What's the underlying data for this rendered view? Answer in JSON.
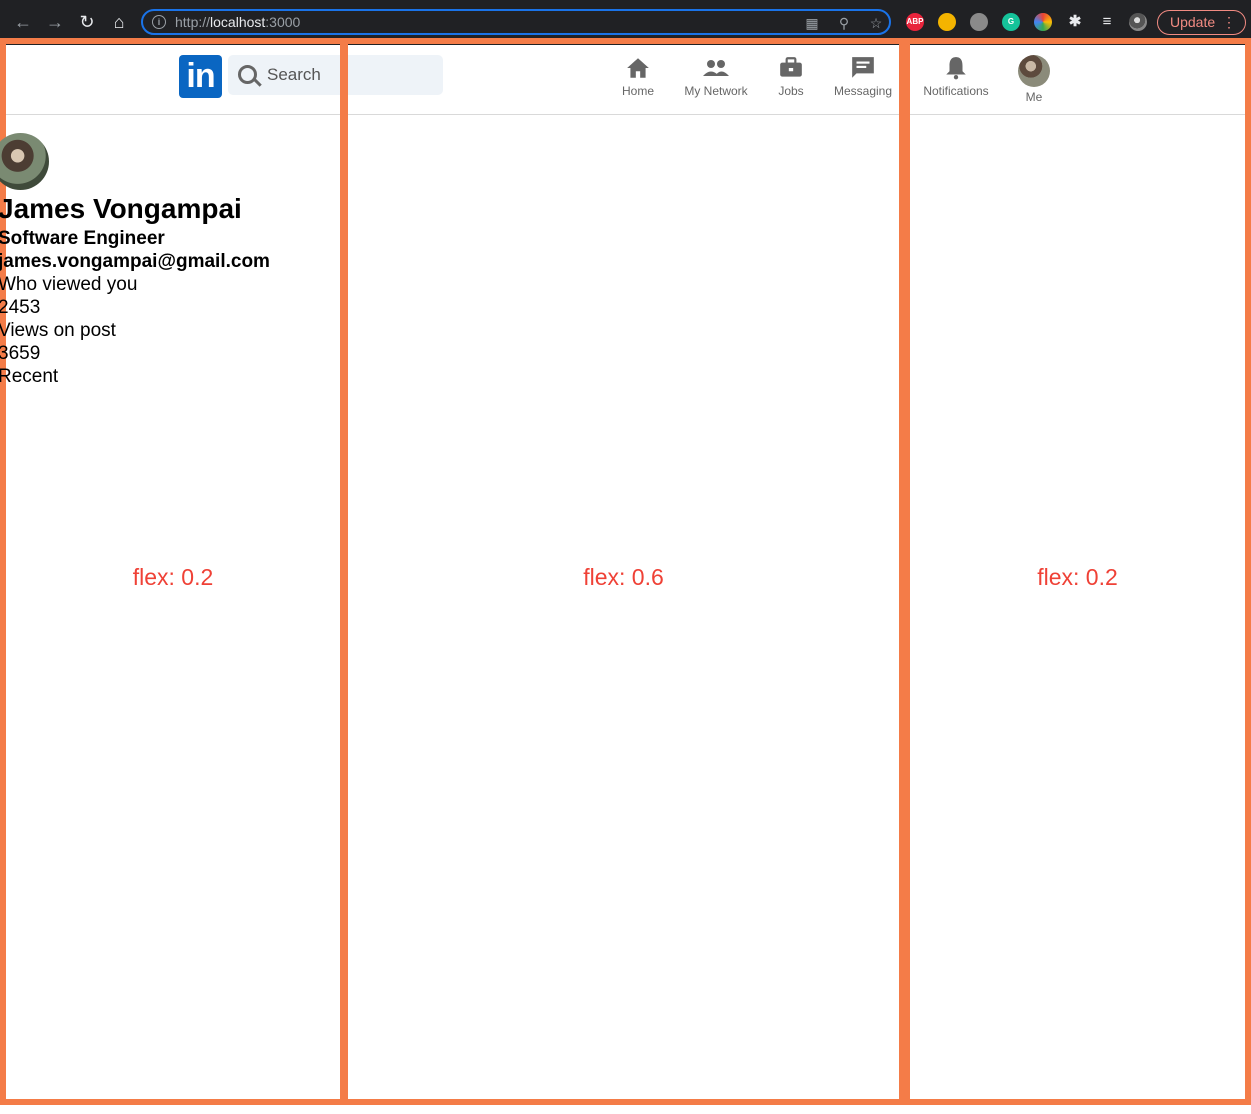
{
  "browser": {
    "url_scheme": "http://",
    "url_host": "localhost",
    "url_port": ":3000",
    "extensions": [
      "ABP"
    ],
    "update_label": "Update"
  },
  "header": {
    "logo_text": "in",
    "search_placeholder": "Search",
    "options": [
      {
        "label": "Home",
        "icon": "home-icon"
      },
      {
        "label": "My Network",
        "icon": "people-icon"
      },
      {
        "label": "Jobs",
        "icon": "briefcase-icon"
      },
      {
        "label": "Messaging",
        "icon": "message-icon"
      },
      {
        "label": "Notifications",
        "icon": "bell-icon"
      },
      {
        "label": "Me",
        "icon": "avatar"
      }
    ]
  },
  "sidebar": {
    "name": "James Vongampai",
    "title": "Software Engineer",
    "email": "james.vongampai@gmail.com",
    "stats": [
      {
        "label": "Who viewed you",
        "value": "2453"
      },
      {
        "label": "Views on post",
        "value": "3659"
      }
    ],
    "recent_label": "Recent"
  },
  "layout_labels": {
    "left": "flex: 0.2",
    "center": "flex: 0.6",
    "right": "flex: 0.2"
  },
  "colors": {
    "column_border": "#f47c48",
    "flex_label": "#ef4136",
    "linkedin_blue": "#0a66c2"
  }
}
